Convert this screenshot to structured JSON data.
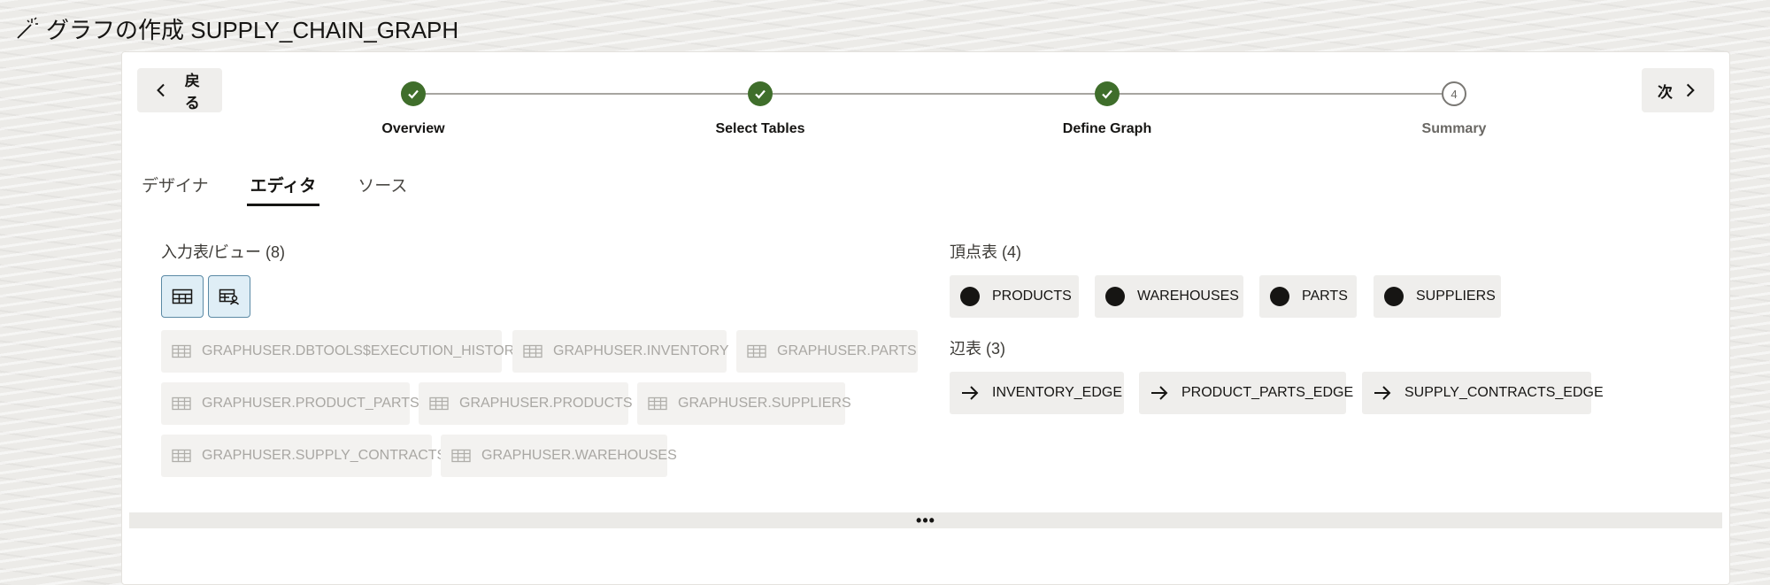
{
  "page": {
    "title": "グラフの作成 SUPPLY_CHAIN_GRAPH",
    "title_icon": "magic-wand-icon"
  },
  "wizard": {
    "back_label": "戻る",
    "next_label": "次",
    "steps": [
      {
        "label": "Overview",
        "status": "complete"
      },
      {
        "label": "Select Tables",
        "status": "complete"
      },
      {
        "label": "Define Graph",
        "status": "complete"
      },
      {
        "label": "Summary",
        "status": "pending",
        "number": "4"
      }
    ]
  },
  "tabs": [
    {
      "label": "デザイナ",
      "active": false
    },
    {
      "label": "エディタ",
      "active": true
    },
    {
      "label": "ソース",
      "active": false
    }
  ],
  "input_tables": {
    "heading": "入力表/ビュー (8)",
    "items": [
      "GRAPHUSER.DBTOOLS$EXECUTION_HISTORY",
      "GRAPHUSER.INVENTORY",
      "GRAPHUSER.PARTS",
      "GRAPHUSER.PRODUCT_PARTS",
      "GRAPHUSER.PRODUCTS",
      "GRAPHUSER.SUPPLIERS",
      "GRAPHUSER.SUPPLY_CONTRACTS",
      "GRAPHUSER.WAREHOUSES"
    ]
  },
  "vertex_tables": {
    "heading": "頂点表 (4)",
    "items": [
      "PRODUCTS",
      "WAREHOUSES",
      "PARTS",
      "SUPPLIERS"
    ]
  },
  "edge_tables": {
    "heading": "辺表 (3)",
    "items": [
      "INVENTORY_EDGE",
      "PRODUCT_PARTS_EDGE",
      "SUPPLY_CONTRACTS_EDGE"
    ]
  },
  "splitter": {
    "label": "•••"
  },
  "colors": {
    "step_complete": "#3f6e2b",
    "toggle_bg": "#dfeef6",
    "toggle_border": "#5b8aa5"
  }
}
